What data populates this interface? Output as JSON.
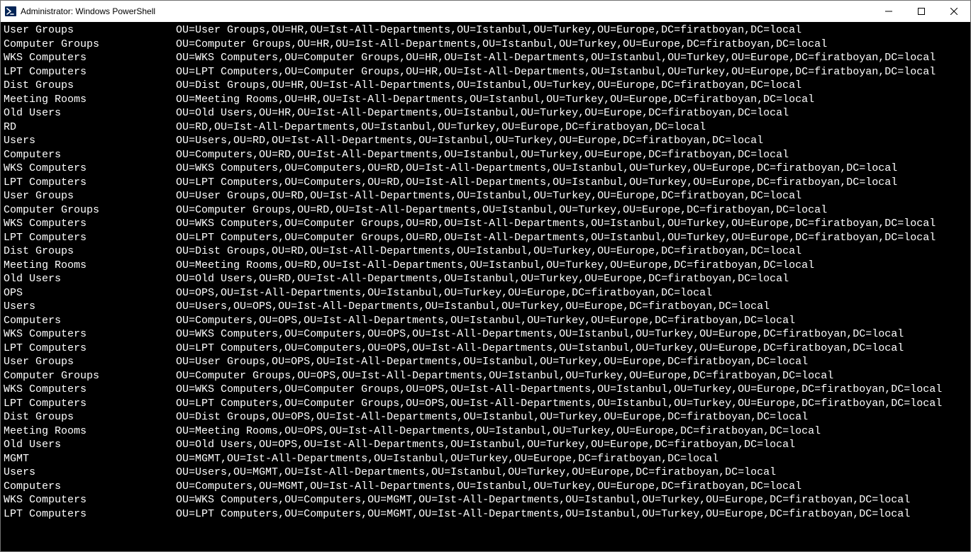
{
  "window": {
    "title": "Administrator: Windows PowerShell"
  },
  "rows": [
    {
      "name": "User Groups",
      "dn": "OU=User Groups,OU=HR,OU=Ist-All-Departments,OU=Istanbul,OU=Turkey,OU=Europe,DC=firatboyan,DC=local"
    },
    {
      "name": "Computer Groups",
      "dn": "OU=Computer Groups,OU=HR,OU=Ist-All-Departments,OU=Istanbul,OU=Turkey,OU=Europe,DC=firatboyan,DC=local"
    },
    {
      "name": "WKS Computers",
      "dn": "OU=WKS Computers,OU=Computer Groups,OU=HR,OU=Ist-All-Departments,OU=Istanbul,OU=Turkey,OU=Europe,DC=firatboyan,DC=local"
    },
    {
      "name": "LPT Computers",
      "dn": "OU=LPT Computers,OU=Computer Groups,OU=HR,OU=Ist-All-Departments,OU=Istanbul,OU=Turkey,OU=Europe,DC=firatboyan,DC=local"
    },
    {
      "name": "Dist Groups",
      "dn": "OU=Dist Groups,OU=HR,OU=Ist-All-Departments,OU=Istanbul,OU=Turkey,OU=Europe,DC=firatboyan,DC=local"
    },
    {
      "name": "Meeting Rooms",
      "dn": "OU=Meeting Rooms,OU=HR,OU=Ist-All-Departments,OU=Istanbul,OU=Turkey,OU=Europe,DC=firatboyan,DC=local"
    },
    {
      "name": "Old Users",
      "dn": "OU=Old Users,OU=HR,OU=Ist-All-Departments,OU=Istanbul,OU=Turkey,OU=Europe,DC=firatboyan,DC=local"
    },
    {
      "name": "RD",
      "dn": "OU=RD,OU=Ist-All-Departments,OU=Istanbul,OU=Turkey,OU=Europe,DC=firatboyan,DC=local"
    },
    {
      "name": "Users",
      "dn": "OU=Users,OU=RD,OU=Ist-All-Departments,OU=Istanbul,OU=Turkey,OU=Europe,DC=firatboyan,DC=local"
    },
    {
      "name": "Computers",
      "dn": "OU=Computers,OU=RD,OU=Ist-All-Departments,OU=Istanbul,OU=Turkey,OU=Europe,DC=firatboyan,DC=local"
    },
    {
      "name": "WKS Computers",
      "dn": "OU=WKS Computers,OU=Computers,OU=RD,OU=Ist-All-Departments,OU=Istanbul,OU=Turkey,OU=Europe,DC=firatboyan,DC=local"
    },
    {
      "name": "LPT Computers",
      "dn": "OU=LPT Computers,OU=Computers,OU=RD,OU=Ist-All-Departments,OU=Istanbul,OU=Turkey,OU=Europe,DC=firatboyan,DC=local"
    },
    {
      "name": "User Groups",
      "dn": "OU=User Groups,OU=RD,OU=Ist-All-Departments,OU=Istanbul,OU=Turkey,OU=Europe,DC=firatboyan,DC=local"
    },
    {
      "name": "Computer Groups",
      "dn": "OU=Computer Groups,OU=RD,OU=Ist-All-Departments,OU=Istanbul,OU=Turkey,OU=Europe,DC=firatboyan,DC=local"
    },
    {
      "name": "WKS Computers",
      "dn": "OU=WKS Computers,OU=Computer Groups,OU=RD,OU=Ist-All-Departments,OU=Istanbul,OU=Turkey,OU=Europe,DC=firatboyan,DC=local"
    },
    {
      "name": "LPT Computers",
      "dn": "OU=LPT Computers,OU=Computer Groups,OU=RD,OU=Ist-All-Departments,OU=Istanbul,OU=Turkey,OU=Europe,DC=firatboyan,DC=local"
    },
    {
      "name": "Dist Groups",
      "dn": "OU=Dist Groups,OU=RD,OU=Ist-All-Departments,OU=Istanbul,OU=Turkey,OU=Europe,DC=firatboyan,DC=local"
    },
    {
      "name": "Meeting Rooms",
      "dn": "OU=Meeting Rooms,OU=RD,OU=Ist-All-Departments,OU=Istanbul,OU=Turkey,OU=Europe,DC=firatboyan,DC=local"
    },
    {
      "name": "Old Users",
      "dn": "OU=Old Users,OU=RD,OU=Ist-All-Departments,OU=Istanbul,OU=Turkey,OU=Europe,DC=firatboyan,DC=local"
    },
    {
      "name": "OPS",
      "dn": "OU=OPS,OU=Ist-All-Departments,OU=Istanbul,OU=Turkey,OU=Europe,DC=firatboyan,DC=local"
    },
    {
      "name": "Users",
      "dn": "OU=Users,OU=OPS,OU=Ist-All-Departments,OU=Istanbul,OU=Turkey,OU=Europe,DC=firatboyan,DC=local"
    },
    {
      "name": "Computers",
      "dn": "OU=Computers,OU=OPS,OU=Ist-All-Departments,OU=Istanbul,OU=Turkey,OU=Europe,DC=firatboyan,DC=local"
    },
    {
      "name": "WKS Computers",
      "dn": "OU=WKS Computers,OU=Computers,OU=OPS,OU=Ist-All-Departments,OU=Istanbul,OU=Turkey,OU=Europe,DC=firatboyan,DC=local"
    },
    {
      "name": "LPT Computers",
      "dn": "OU=LPT Computers,OU=Computers,OU=OPS,OU=Ist-All-Departments,OU=Istanbul,OU=Turkey,OU=Europe,DC=firatboyan,DC=local"
    },
    {
      "name": "User Groups",
      "dn": "OU=User Groups,OU=OPS,OU=Ist-All-Departments,OU=Istanbul,OU=Turkey,OU=Europe,DC=firatboyan,DC=local"
    },
    {
      "name": "Computer Groups",
      "dn": "OU=Computer Groups,OU=OPS,OU=Ist-All-Departments,OU=Istanbul,OU=Turkey,OU=Europe,DC=firatboyan,DC=local"
    },
    {
      "name": "WKS Computers",
      "dn": "OU=WKS Computers,OU=Computer Groups,OU=OPS,OU=Ist-All-Departments,OU=Istanbul,OU=Turkey,OU=Europe,DC=firatboyan,DC=local"
    },
    {
      "name": "LPT Computers",
      "dn": "OU=LPT Computers,OU=Computer Groups,OU=OPS,OU=Ist-All-Departments,OU=Istanbul,OU=Turkey,OU=Europe,DC=firatboyan,DC=local"
    },
    {
      "name": "Dist Groups",
      "dn": "OU=Dist Groups,OU=OPS,OU=Ist-All-Departments,OU=Istanbul,OU=Turkey,OU=Europe,DC=firatboyan,DC=local"
    },
    {
      "name": "Meeting Rooms",
      "dn": "OU=Meeting Rooms,OU=OPS,OU=Ist-All-Departments,OU=Istanbul,OU=Turkey,OU=Europe,DC=firatboyan,DC=local"
    },
    {
      "name": "Old Users",
      "dn": "OU=Old Users,OU=OPS,OU=Ist-All-Departments,OU=Istanbul,OU=Turkey,OU=Europe,DC=firatboyan,DC=local"
    },
    {
      "name": "MGMT",
      "dn": "OU=MGMT,OU=Ist-All-Departments,OU=Istanbul,OU=Turkey,OU=Europe,DC=firatboyan,DC=local"
    },
    {
      "name": "Users",
      "dn": "OU=Users,OU=MGMT,OU=Ist-All-Departments,OU=Istanbul,OU=Turkey,OU=Europe,DC=firatboyan,DC=local"
    },
    {
      "name": "Computers",
      "dn": "OU=Computers,OU=MGMT,OU=Ist-All-Departments,OU=Istanbul,OU=Turkey,OU=Europe,DC=firatboyan,DC=local"
    },
    {
      "name": "WKS Computers",
      "dn": "OU=WKS Computers,OU=Computers,OU=MGMT,OU=Ist-All-Departments,OU=Istanbul,OU=Turkey,OU=Europe,DC=firatboyan,DC=local"
    },
    {
      "name": "LPT Computers",
      "dn": "OU=LPT Computers,OU=Computers,OU=MGMT,OU=Ist-All-Departments,OU=Istanbul,OU=Turkey,OU=Europe,DC=firatboyan,DC=local"
    }
  ],
  "layout": {
    "name_col_width": 27
  }
}
